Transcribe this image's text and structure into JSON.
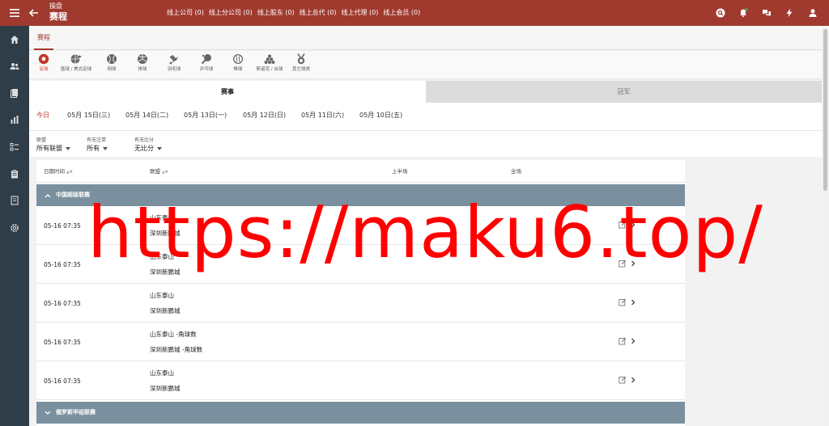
{
  "header": {
    "breadcrumb": "操盘",
    "title": "赛程",
    "stats": [
      "线上公司 (0)",
      "线上分公司 (0)",
      "线上股东 (0)",
      "线上总代 (0)",
      "线上代理 (0)",
      "线上会员 (0)"
    ],
    "icons": [
      "menu-icon",
      "back-arrow-icon",
      "search-icon",
      "bell-icon",
      "chat-icon",
      "bolt-icon",
      "user-icon"
    ],
    "accent_color": "#a0392e"
  },
  "sidebar": {
    "icons": [
      "home-icon",
      "users-icon",
      "book-icon",
      "bar-chart-icon",
      "list-icon",
      "clipboard-icon",
      "report-icon",
      "settings-icon"
    ],
    "bg_color": "#2f3d48"
  },
  "tabs": [
    "赛程"
  ],
  "sports": [
    {
      "label": "足球",
      "icon": "soccer-icon",
      "active": true
    },
    {
      "label": "篮球 / 美式足球",
      "icon": "basketball-icon",
      "active": false
    },
    {
      "label": "网球",
      "icon": "tennis-icon",
      "active": false
    },
    {
      "label": "排球",
      "icon": "volleyball-icon",
      "active": false
    },
    {
      "label": "羽毛球",
      "icon": "badminton-icon",
      "active": false
    },
    {
      "label": "乒乓球",
      "icon": "pingpong-icon",
      "active": false
    },
    {
      "label": "棒球",
      "icon": "baseball-icon",
      "active": false
    },
    {
      "label": "斯诺克 / 台球",
      "icon": "snooker-icon",
      "active": false
    },
    {
      "label": "其它球类",
      "icon": "medal-icon",
      "active": false
    }
  ],
  "main_tabs": [
    "赛事",
    "冠军"
  ],
  "dates": [
    "今日",
    "05月 15日(三)",
    "05月 14日(二)",
    "05月 13日(一)",
    "05月 12日(日)",
    "05月 11日(六)",
    "05月 10日(五)"
  ],
  "filters": [
    {
      "label": "联盟",
      "value": "所有联盟"
    },
    {
      "label": "有无注单",
      "value": "所有"
    },
    {
      "label": "有无比分",
      "value": "无比分"
    }
  ],
  "table": {
    "headers": [
      "日期时间",
      "联盟",
      "上半场",
      "全场"
    ],
    "groups": [
      {
        "name": "中国超级联赛",
        "expanded": true,
        "rows": [
          {
            "time": "05-16 07:35",
            "home": "山东泰山",
            "away": "深圳新鹏城"
          },
          {
            "time": "05-16 07:35",
            "home": "山东泰山",
            "away": "深圳新鹏城"
          },
          {
            "time": "05-16 07:35",
            "home": "山东泰山",
            "away": "深圳新鹏城"
          },
          {
            "time": "05-16 07:35",
            "home": "山东泰山 -角球数",
            "away": "深圳新鹏城 -角球数"
          },
          {
            "time": "05-16 07:35",
            "home": "山东泰山",
            "away": "深圳新鹏城"
          }
        ]
      },
      {
        "name": "俄罗斯甲组联赛",
        "expanded": false,
        "rows": []
      }
    ],
    "group_color": "#7b909e"
  },
  "watermark": "https://maku6.top/"
}
